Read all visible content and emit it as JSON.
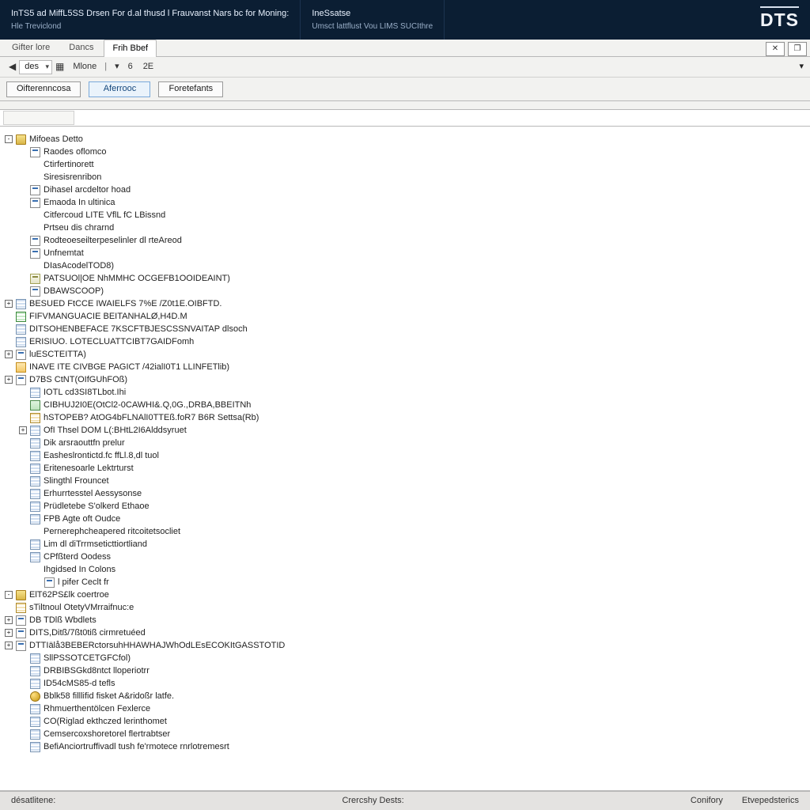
{
  "titlebar": {
    "left_top": "InTS5 ad MiffL5SS Drsen For d.al thusd l Frauvanst Nars bc for Moning:",
    "left_sub": "Hle Treviclond",
    "mid_top": "IneSsatse",
    "mid_sub": "Umsct lattflust Vou LIMS SUCIthre",
    "logo": "DTS"
  },
  "menu": {
    "tabs": [
      {
        "label": "Gifter lore",
        "active": false
      },
      {
        "label": "Dancs",
        "active": false
      },
      {
        "label": "Frih Bbef",
        "active": true
      }
    ],
    "close_glyph": "✕",
    "restore_glyph": "❐"
  },
  "toolbar": {
    "nav_prev": "◀",
    "nav_dd": "des",
    "nav_grid": "▦",
    "zoom_label": "Mlone",
    "zoom_pipe": "|",
    "page_current": "6",
    "page_total": "2E",
    "overflow": "▾"
  },
  "buttons": {
    "b1": "Oifterenncosa",
    "b2": "Aferrooc",
    "b3": "Foretefants"
  },
  "filter": {
    "placeholder": ""
  },
  "status": {
    "left": "désatlitene:",
    "mid": "Crercshy Dests:",
    "r1": "Conifory",
    "r2": "Etvepedsterics"
  },
  "tree": [
    {
      "d": 0,
      "tg": "-",
      "ic": "folder",
      "label": "Mifoeas Detto"
    },
    {
      "d": 1,
      "tg": "",
      "ic": "report",
      "label": "Raodes oflomco"
    },
    {
      "d": 1,
      "tg": "",
      "ic": "blank",
      "label": "Ctirfertinorett"
    },
    {
      "d": 1,
      "tg": "",
      "ic": "blank",
      "label": "Siresisrenribon"
    },
    {
      "d": 1,
      "tg": "",
      "ic": "report",
      "label": "Dihasel arcdeltor hoad"
    },
    {
      "d": 1,
      "tg": "",
      "ic": "report",
      "label": "Emaoda In ultinica"
    },
    {
      "d": 1,
      "tg": "",
      "ic": "blank",
      "label": "Citfercoud LITE VflL fC LBissnd"
    },
    {
      "d": 1,
      "tg": "",
      "ic": "blank",
      "label": "Prtseu dis chrarnd"
    },
    {
      "d": 1,
      "tg": "",
      "ic": "report",
      "label": "Rodteoeseilterpeselinler dl rteAreod"
    },
    {
      "d": 1,
      "tg": "",
      "ic": "report",
      "label": "Unfnemtat"
    },
    {
      "d": 1,
      "tg": "",
      "ic": "blank",
      "label": "DIasAcodelTOD8)"
    },
    {
      "d": 1,
      "tg": "",
      "ic": "script",
      "label": "PATSUOl|OE NhMMHC OCGEFB1OOIDEAINT)"
    },
    {
      "d": 1,
      "tg": "",
      "ic": "report",
      "label": "DBAWSCOOP)"
    },
    {
      "d": 0,
      "tg": "+",
      "ic": "table",
      "label": "BESUED FtCCE IWAIELFS 7%E /Z0t1E.OIBFTD."
    },
    {
      "d": 0,
      "tg": "",
      "ic": "table-green",
      "label": "FIFVMANGUACIE BEITANHALØ,H4D.M"
    },
    {
      "d": 0,
      "tg": "",
      "ic": "table",
      "label": "DITSOHENBEFACE 7KSCFTBJESCSSNVAITAP dlsoch"
    },
    {
      "d": 0,
      "tg": "",
      "ic": "table",
      "label": "ERISIUO. LOTECLUATTCIBT7GAIDFomh"
    },
    {
      "d": 0,
      "tg": "+",
      "ic": "report",
      "label": "luESCTEITTA)"
    },
    {
      "d": 0,
      "tg": "",
      "ic": "warn",
      "label": "INAVE ITE CIVBGE PAGICT /42ialI0T1 LLINFETlib)"
    },
    {
      "d": 0,
      "tg": "+",
      "ic": "report",
      "label": "D7BS CtNT(OIfGUhFOß)"
    },
    {
      "d": 1,
      "tg": "",
      "ic": "table",
      "label": "IOTL cd3SI8TLbot.Ihi"
    },
    {
      "d": 1,
      "tg": "",
      "ic": "proc",
      "label": "CIBHUJ2I0E(OtCl2-0CAWHI&.Q,0G.,DRBA,BBEITNh"
    },
    {
      "d": 1,
      "tg": "",
      "ic": "table-gold",
      "label": "hSTOPEB? AtOG4bFLNAlI0TTEß.foR7 B6R Settsa(Rb)"
    },
    {
      "d": 1,
      "tg": "+",
      "ic": "table",
      "label": "OfI Thsel DOM L(:BHtL2I6Alddsyruet"
    },
    {
      "d": 1,
      "tg": "",
      "ic": "table",
      "label": "Dik arsraouttfn prelur"
    },
    {
      "d": 1,
      "tg": "",
      "ic": "table",
      "label": "Easheslrontictd.fc ffLl.8,dl tuol"
    },
    {
      "d": 1,
      "tg": "",
      "ic": "table",
      "label": "Eritenesoarle Lektrturst"
    },
    {
      "d": 1,
      "tg": "",
      "ic": "table",
      "label": "Slingthl Frouncet"
    },
    {
      "d": 1,
      "tg": "",
      "ic": "table",
      "label": "Erhurrtesstel Aessysonse"
    },
    {
      "d": 1,
      "tg": "",
      "ic": "table",
      "label": "Prüdletebe S'olkerd Ethaoe"
    },
    {
      "d": 1,
      "tg": "",
      "ic": "table",
      "label": "FPB Agte oft Oudce"
    },
    {
      "d": 1,
      "tg": "",
      "ic": "blank",
      "label": "Pernerephcheapered ritcoitetsocliet"
    },
    {
      "d": 1,
      "tg": "",
      "ic": "table",
      "label": "Lim dl diTrrmseticttiortliand"
    },
    {
      "d": 1,
      "tg": "",
      "ic": "table",
      "label": "CPfßterd Oodess"
    },
    {
      "d": 1,
      "tg": "",
      "ic": "blank",
      "label": "Ihgidsed In Colons"
    },
    {
      "d": 2,
      "tg": "",
      "ic": "report",
      "label": "l pifer Ceclt fr"
    },
    {
      "d": 0,
      "tg": "-",
      "ic": "folder",
      "label": "ElT62PS£lk coertroe"
    },
    {
      "d": 0,
      "tg": "",
      "ic": "table-gold",
      "label": "sTiltnoul OtetyVMrraifnuc:e"
    },
    {
      "d": 0,
      "tg": "+",
      "ic": "report",
      "label": "DB TDlß Wbdlets"
    },
    {
      "d": 0,
      "tg": "+",
      "ic": "report",
      "label": "DITS,Ditß/7ßt0tiß cirmretuéed"
    },
    {
      "d": 0,
      "tg": "+",
      "ic": "report",
      "label": "DTTIälå3BEBERctorsuhHHAWHAJWhOdLEsECOKItGASSTOTID"
    },
    {
      "d": 1,
      "tg": "",
      "ic": "table",
      "label": "SllPSSOTCETGFCfol)"
    },
    {
      "d": 1,
      "tg": "",
      "ic": "table",
      "label": "DRBIBSGkd8ntct lloperiotrr"
    },
    {
      "d": 1,
      "tg": "",
      "ic": "table",
      "label": "ID54cMS85-d tefls"
    },
    {
      "d": 1,
      "tg": "",
      "ic": "key",
      "label": "Bblk58 filllifid fisket A&ridoßr latfe."
    },
    {
      "d": 1,
      "tg": "",
      "ic": "table",
      "label": "Rhmuerthentölcen Fexlerce"
    },
    {
      "d": 1,
      "tg": "",
      "ic": "table",
      "label": "CO(Riglad ekthczed lerinthomet"
    },
    {
      "d": 1,
      "tg": "",
      "ic": "table",
      "label": "Cemsercoxshoretorel flertrabtser"
    },
    {
      "d": 1,
      "tg": "",
      "ic": "table",
      "label": "BefiAnciortruffivadl tush fe'rmotece rnrlotremesrt"
    }
  ]
}
